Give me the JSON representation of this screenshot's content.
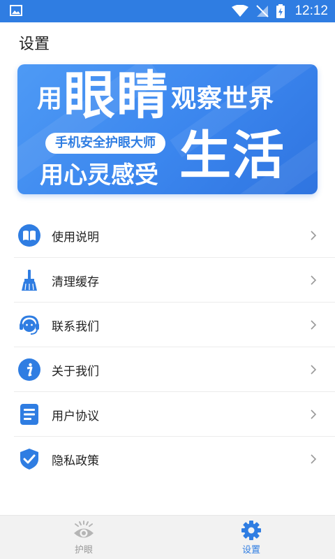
{
  "status_bar": {
    "time": "12:12"
  },
  "page_title": "设置",
  "banner": {
    "line1_prefix": "用",
    "line1_big": "眼睛",
    "line1_suffix": "观察世界",
    "pill_text": "手机安全护眼大师",
    "line2": "用心灵感受",
    "line2_big": "生活"
  },
  "menu": {
    "items": [
      {
        "label": "使用说明",
        "icon": "book-icon"
      },
      {
        "label": "清理缓存",
        "icon": "broom-icon"
      },
      {
        "label": "联系我们",
        "icon": "headset-icon"
      },
      {
        "label": "关于我们",
        "icon": "info-icon"
      },
      {
        "label": "用户协议",
        "icon": "document-icon"
      },
      {
        "label": "隐私政策",
        "icon": "shield-check-icon"
      }
    ]
  },
  "bottom_nav": {
    "tabs": [
      {
        "label": "护眼",
        "icon": "eye-icon",
        "active": false
      },
      {
        "label": "设置",
        "icon": "gear-icon",
        "active": true
      }
    ]
  },
  "colors": {
    "primary": "#2f7de2",
    "inactive": "#9a9a9a"
  }
}
